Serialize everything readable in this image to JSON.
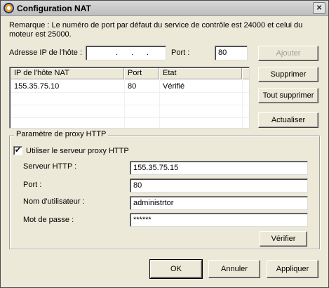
{
  "window": {
    "title": "Configuration NAT",
    "close_glyph": "×"
  },
  "note": "Remarque : Le numéro de port par défaut du service de contrôle est 24000 et celui du moteur est 25000.",
  "host": {
    "ip_label": "Adresse IP de l'hôte :",
    "ip_dot": ".",
    "port_label": "Port :",
    "port_value": "80",
    "add_label": "Ajouter"
  },
  "table": {
    "headers": [
      "IP de l'hôte NAT",
      "Port",
      "Etat"
    ],
    "rows": [
      {
        "ip": "155.35.75.10",
        "port": "80",
        "status": "Vérifié"
      }
    ]
  },
  "side_buttons": {
    "delete": "Supprimer",
    "delete_all": "Tout supprimer",
    "refresh": "Actualiser"
  },
  "proxy": {
    "group_title": "Paramètre de proxy HTTP",
    "use_proxy_label": "Utiliser le serveur proxy HTTP",
    "use_proxy_checked": true,
    "check_glyph": "✔",
    "server_label": "Serveur HTTP :",
    "server_value": "155.35.75.15",
    "port_label": "Port :",
    "port_value": "80",
    "user_label": "Nom d'utilisateur :",
    "user_value": "administrtor",
    "password_label": "Mot de passe :",
    "password_value": "******",
    "verify_label": "Vérifier"
  },
  "footer": {
    "ok": "OK",
    "cancel": "Annuler",
    "apply": "Appliquer"
  }
}
